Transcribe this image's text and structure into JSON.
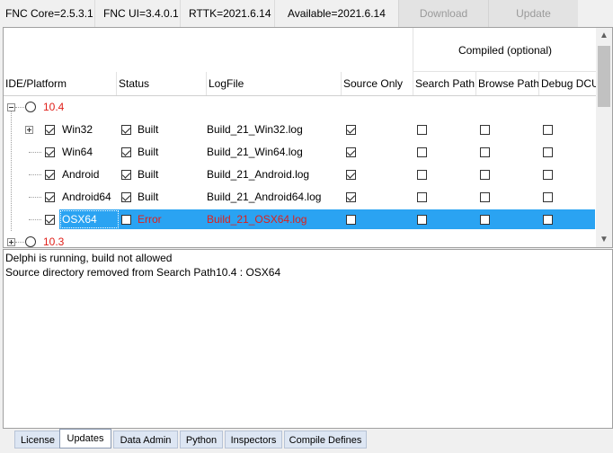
{
  "topbar": {
    "fnc_core": "FNC Core=2.5.3.1",
    "fnc_ui": "FNC UI=3.4.0.1",
    "rttk": "RTTK=2021.6.14",
    "available": "Available=2021.6.14",
    "download_label": "Download",
    "update_label": "Update"
  },
  "grid": {
    "group_header": "Compiled (optional)",
    "columns": [
      "IDE/Platform",
      "Status",
      "LogFile",
      "Source Only",
      "Search Path",
      "Browse Path",
      "Debug DCU"
    ],
    "groups": [
      {
        "name": "10.4",
        "expanded": true
      },
      {
        "name": "10.3",
        "expanded": false
      }
    ],
    "rows": [
      {
        "platform": "Win32",
        "expander": "plus",
        "platform_checked": true,
        "status": "Built",
        "status_checked": true,
        "error": false,
        "logfile": "Build_21_Win32.log",
        "source_only": true,
        "search_path": false,
        "browse_path": false,
        "debug_dcu": false
      },
      {
        "platform": "Win64",
        "expander": "",
        "platform_checked": true,
        "status": "Built",
        "status_checked": true,
        "error": false,
        "logfile": "Build_21_Win64.log",
        "source_only": true,
        "search_path": false,
        "browse_path": false,
        "debug_dcu": false
      },
      {
        "platform": "Android",
        "expander": "",
        "platform_checked": true,
        "status": "Built",
        "status_checked": true,
        "error": false,
        "logfile": "Build_21_Android.log",
        "source_only": true,
        "search_path": false,
        "browse_path": false,
        "debug_dcu": false
      },
      {
        "platform": "Android64",
        "expander": "",
        "platform_checked": true,
        "status": "Built",
        "status_checked": true,
        "error": false,
        "logfile": "Build_21_Android64.log",
        "source_only": true,
        "search_path": false,
        "browse_path": false,
        "debug_dcu": false
      },
      {
        "platform": "OSX64",
        "expander": "",
        "platform_checked": true,
        "status": "Error",
        "status_checked": false,
        "error": true,
        "selected": true,
        "logfile": "Build_21_OSX64.log",
        "source_only": false,
        "search_path": false,
        "browse_path": false,
        "debug_dcu": false
      }
    ]
  },
  "log": {
    "lines": [
      "Delphi is running, build not allowed",
      "Source directory removed from Search Path10.4 : OSX64"
    ]
  },
  "tabs": {
    "items": [
      "License",
      "Updates",
      "Data Admin",
      "Python",
      "Inspectors",
      "Compile Defines"
    ],
    "active": "Updates"
  },
  "colors": {
    "selection": "#2aa3f2",
    "error": "#e0201a",
    "group_label": "#e0201a"
  }
}
